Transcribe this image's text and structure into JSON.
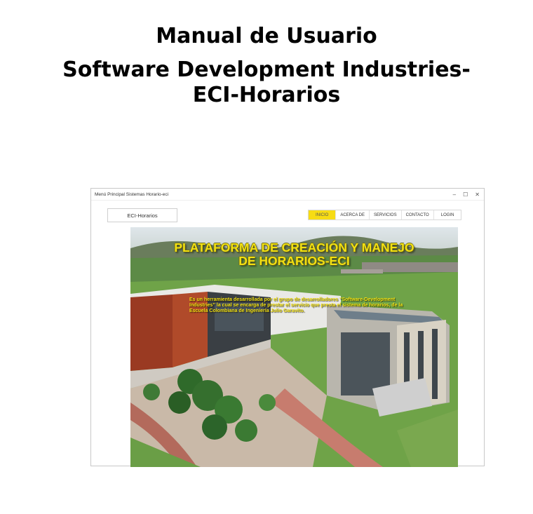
{
  "document": {
    "title_line1": "Manual de Usuario",
    "title_line2": "Software Development Industries-",
    "title_line3": "ECI-Horarios"
  },
  "window": {
    "title": "Menú Principal Sistemas Horario-eci",
    "controls": {
      "minimize": "–",
      "maximize": "☐",
      "close": "✕"
    }
  },
  "app": {
    "logo": "ECI-Horarios",
    "nav": [
      "INICIO",
      "ACERCA DE",
      "SERVICIOS",
      "CONTACTO",
      "LOGIN"
    ],
    "active_nav": "INICIO",
    "accent_color": "#f7dc14"
  },
  "hero": {
    "title_line1": "PLATAFORMA DE CREACIÓN Y MANEJO",
    "title_line2": "DE HORARIOS-ECI",
    "description": "Es un herramienta desarrollada por el grupo de desarrolladores “Software-Development Industries” la cual se encarga de prestar el servicio que presta el sistema de horarios, de la Escuela Colombiana de Ingeniería Julio Garavito."
  }
}
